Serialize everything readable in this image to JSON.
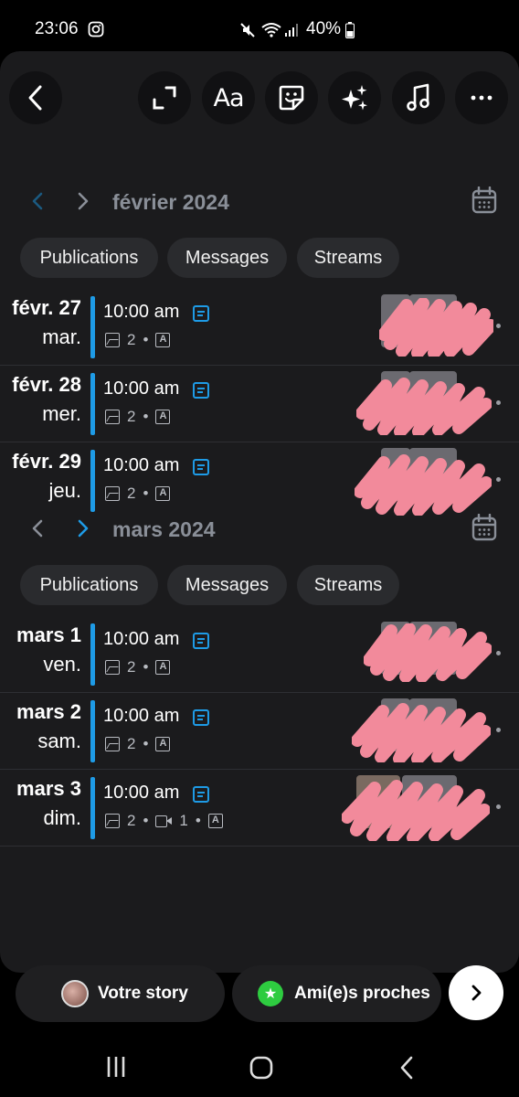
{
  "status_bar": {
    "time": "23:06",
    "battery": "40%",
    "icons": [
      "instagram-icon",
      "mute-icon",
      "wifi-icon",
      "signal-icon",
      "battery-icon"
    ]
  },
  "toolbar": {
    "text_button_label": "Aa",
    "icons": [
      "back-icon",
      "expand-icon",
      "text-icon",
      "sticker-icon",
      "effects-icon",
      "music-icon",
      "more-icon"
    ]
  },
  "months": [
    {
      "label": "février 2024",
      "tabs": [
        "Publications",
        "Messages",
        "Streams"
      ],
      "days": [
        {
          "date": "févr. 27",
          "weekday": "mar.",
          "time": "10:00 am",
          "images": "2",
          "has_video": false,
          "videos": ""
        },
        {
          "date": "févr. 28",
          "weekday": "mer.",
          "time": "10:00 am",
          "images": "2",
          "has_video": false,
          "videos": ""
        },
        {
          "date": "févr. 29",
          "weekday": "jeu.",
          "time": "10:00 am",
          "images": "2",
          "has_video": false,
          "videos": ""
        }
      ]
    },
    {
      "label": "mars 2024",
      "tabs": [
        "Publications",
        "Messages",
        "Streams"
      ],
      "days": [
        {
          "date": "mars 1",
          "weekday": "ven.",
          "time": "10:00 am",
          "images": "2",
          "has_video": false,
          "videos": ""
        },
        {
          "date": "mars 2",
          "weekday": "sam.",
          "time": "10:00 am",
          "images": "2",
          "has_video": false,
          "videos": ""
        },
        {
          "date": "mars 3",
          "weekday": "dim.",
          "time": "10:00 am",
          "images": "2",
          "has_video": true,
          "videos": "1"
        }
      ]
    }
  ],
  "bottom": {
    "your_story": "Votre story",
    "close_friends": "Ami(e)s proches"
  },
  "colors": {
    "accent": "#1e9be6",
    "panel": "#1b1b1d",
    "redaction": "#f28a9b",
    "close_friends_badge": "#2ecc40"
  }
}
